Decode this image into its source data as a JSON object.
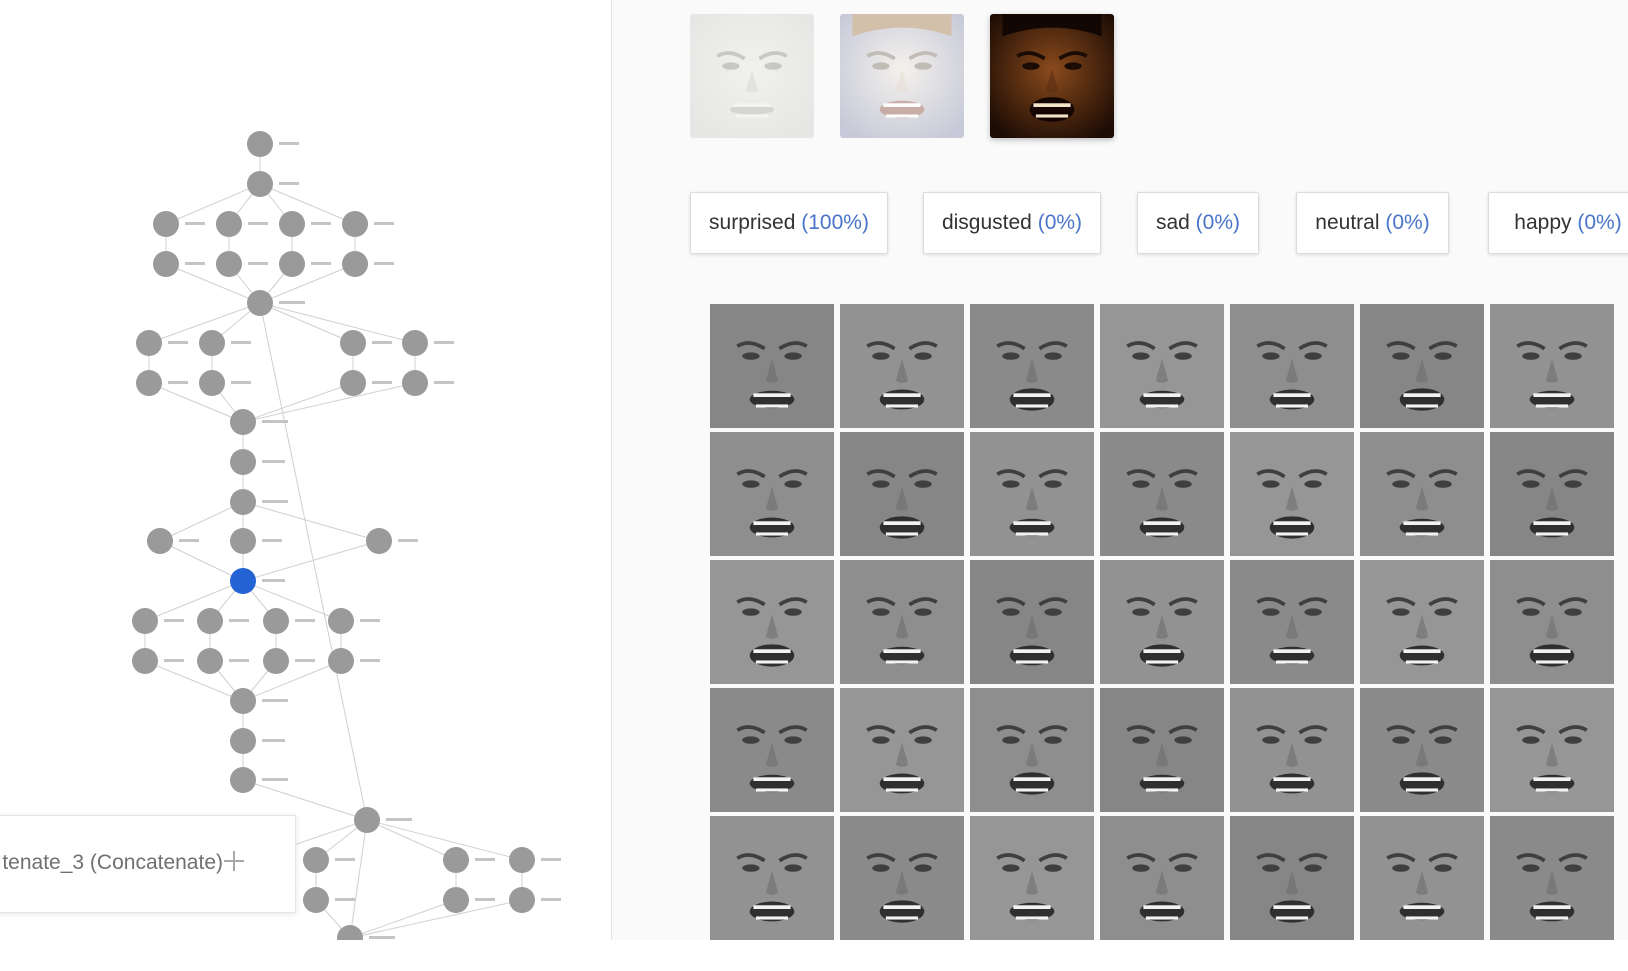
{
  "graph": {
    "selected_layer": "tenate_3 (Concatenate)",
    "colors": {
      "node": "#9a9a9a",
      "selected_node": "#2463d3",
      "edge": "#d0d0d0"
    }
  },
  "thumbnails": [
    {
      "name": "face-1",
      "tone": "pale",
      "selected": false
    },
    {
      "name": "face-2",
      "tone": "child",
      "selected": false
    },
    {
      "name": "face-3",
      "tone": "dark",
      "selected": true
    }
  ],
  "predictions": [
    {
      "label": "surprised",
      "percent": "(100%)"
    },
    {
      "label": "disgusted",
      "percent": "(0%)"
    },
    {
      "label": "sad",
      "percent": "(0%)"
    },
    {
      "label": "neutral",
      "percent": "(0%)"
    },
    {
      "label": "happy",
      "percent": "(0%)"
    }
  ],
  "activation_grid": {
    "rows": 5,
    "cols": 7
  },
  "colors": {
    "accent": "#4a74c9",
    "panel_bg": "#fafafa"
  }
}
